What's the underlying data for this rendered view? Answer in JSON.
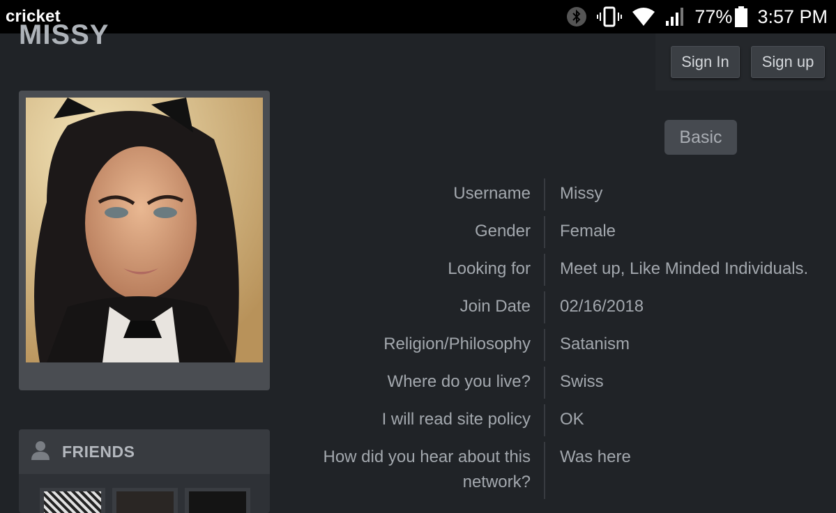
{
  "status_bar": {
    "carrier": "cricket",
    "battery_percent": "77%",
    "time": "3:57 PM",
    "icons": [
      "bluetooth-icon",
      "vibrate-icon",
      "wifi-icon",
      "signal-icon",
      "battery-icon"
    ]
  },
  "page": {
    "title": "MISSY"
  },
  "auth": {
    "sign_in": "Sign In",
    "sign_up": "Sign up"
  },
  "profile": {
    "tab_basic": "Basic",
    "fields": [
      {
        "label": "Username",
        "value": "Missy"
      },
      {
        "label": "Gender",
        "value": "Female"
      },
      {
        "label": "Looking for",
        "value": "Meet up, Like Minded Individuals."
      },
      {
        "label": "Join Date",
        "value": "02/16/2018"
      },
      {
        "label": "Religion/Philosophy",
        "value": "Satanism"
      },
      {
        "label": "Where do you live?",
        "value": "Swiss"
      },
      {
        "label": "I will read site policy",
        "value": "OK"
      },
      {
        "label": "How did you hear about this network?",
        "value": "Was here"
      }
    ]
  },
  "friends": {
    "title": "FRIENDS",
    "icon": "person-icon"
  },
  "colors": {
    "background": "#202327",
    "status_bar": "#000000",
    "button": "#3b3f44",
    "card": "#4a4d52"
  }
}
